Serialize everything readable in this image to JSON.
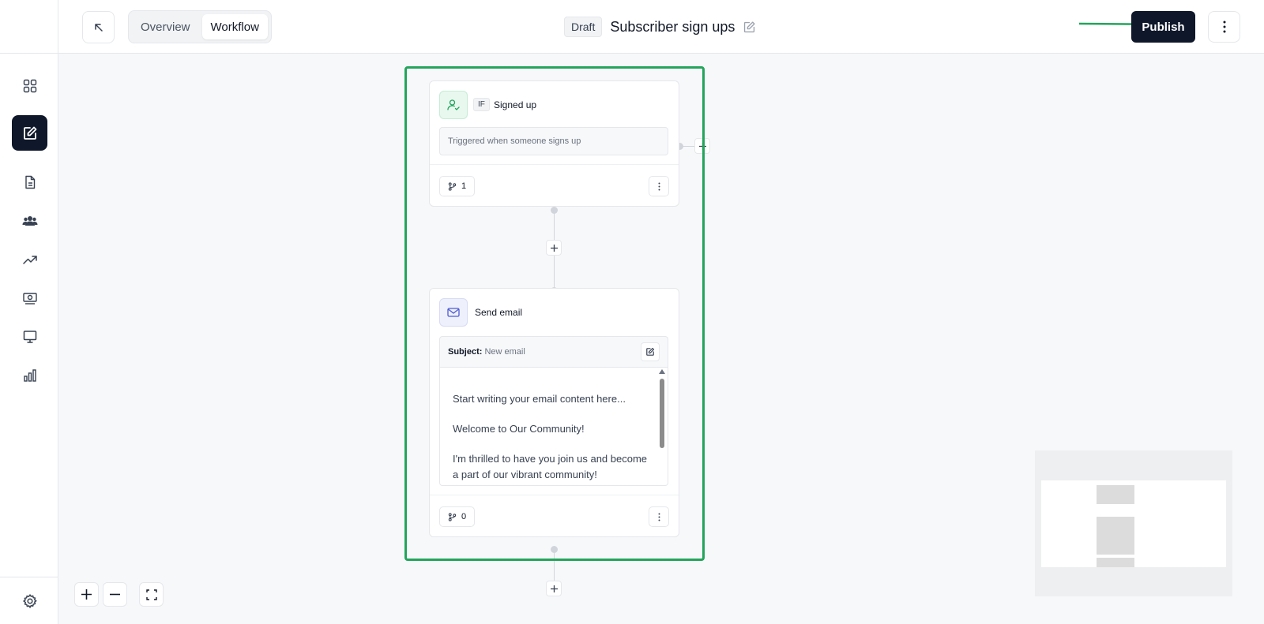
{
  "sidebar": {
    "items": [
      {
        "icon": "dashboard-grid-icon"
      },
      {
        "icon": "edit-square-icon",
        "active": true
      },
      {
        "icon": "document-icon"
      },
      {
        "icon": "users-icon"
      },
      {
        "icon": "trending-up-icon"
      },
      {
        "icon": "money-icon"
      },
      {
        "icon": "monitor-icon"
      },
      {
        "icon": "bar-chart-icon"
      }
    ],
    "footer_icon": "settings-gear-icon"
  },
  "header": {
    "tabs": [
      {
        "label": "Overview",
        "active": false
      },
      {
        "label": "Workflow",
        "active": true
      }
    ],
    "badge": "Draft",
    "title": "Subscriber sign ups",
    "publish_label": "Publish"
  },
  "nodes": {
    "trigger": {
      "badge": "IF",
      "title": "Signed up",
      "description": "Triggered when someone signs up",
      "branch_count": "1"
    },
    "email": {
      "title": "Send email",
      "subject_label": "Subject:",
      "subject_value": "New email",
      "body": [
        "Start writing your email content here...",
        "Welcome to Our Community!",
        "I'm thrilled to have you join us and become a part of our vibrant community!"
      ],
      "branch_count": "0"
    }
  },
  "colors": {
    "accent_dark": "#0f172a",
    "highlight_green": "#22a55b",
    "trigger_icon_bg": "#e8f8ef",
    "email_icon_bg": "#eef0fb"
  }
}
